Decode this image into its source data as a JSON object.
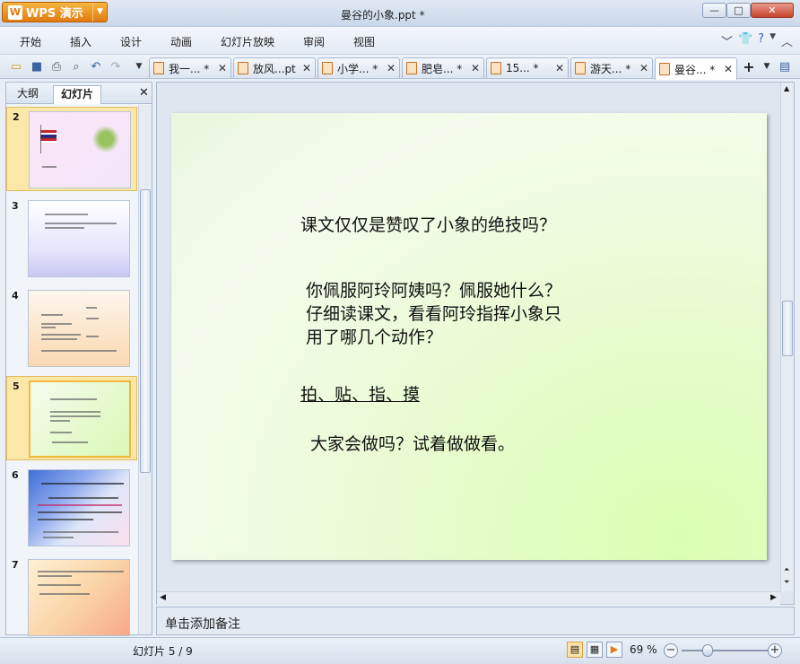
{
  "app": {
    "button_label": "WPS 演示",
    "title": "曼谷的小象.ppt *"
  },
  "window_buttons": {
    "min": "—",
    "max": "□",
    "close": "✕"
  },
  "menu": [
    "开始",
    "插入",
    "设计",
    "动画",
    "幻灯片放映",
    "审阅",
    "视图"
  ],
  "doc_tabs": [
    {
      "label": "我一...  *"
    },
    {
      "label": "放风...pt"
    },
    {
      "label": "小学...  *"
    },
    {
      "label": "肥皂...  *"
    },
    {
      "label": "15...  *"
    },
    {
      "label": "游天...  *"
    },
    {
      "label": "曼谷...  *"
    }
  ],
  "left_pane": {
    "tab_outline": "大纲",
    "tab_slides": "幻灯片",
    "close": "✕"
  },
  "thumbnails": [
    {
      "num": "2"
    },
    {
      "num": "3"
    },
    {
      "num": "4"
    },
    {
      "num": "5"
    },
    {
      "num": "6"
    },
    {
      "num": "7"
    }
  ],
  "slide": {
    "line1": "课文仅仅是赞叹了小象的绝技吗？",
    "line2": "你佩服阿玲阿姨吗？佩服她什么？",
    "line3": "仔细读课文，看看阿玲指挥小象只",
    "line4": "用了哪几个动作？",
    "line5": "拍、贴、指、摸",
    "line6": "大家会做吗？试着做做看。"
  },
  "notes": {
    "placeholder": "单击添加备注"
  },
  "status": {
    "slide_counter": "幻灯片 5 / 9",
    "zoom": "69 %"
  },
  "colors": {
    "accent_orange": "#e27a10",
    "selection": "#fbe8a8"
  }
}
